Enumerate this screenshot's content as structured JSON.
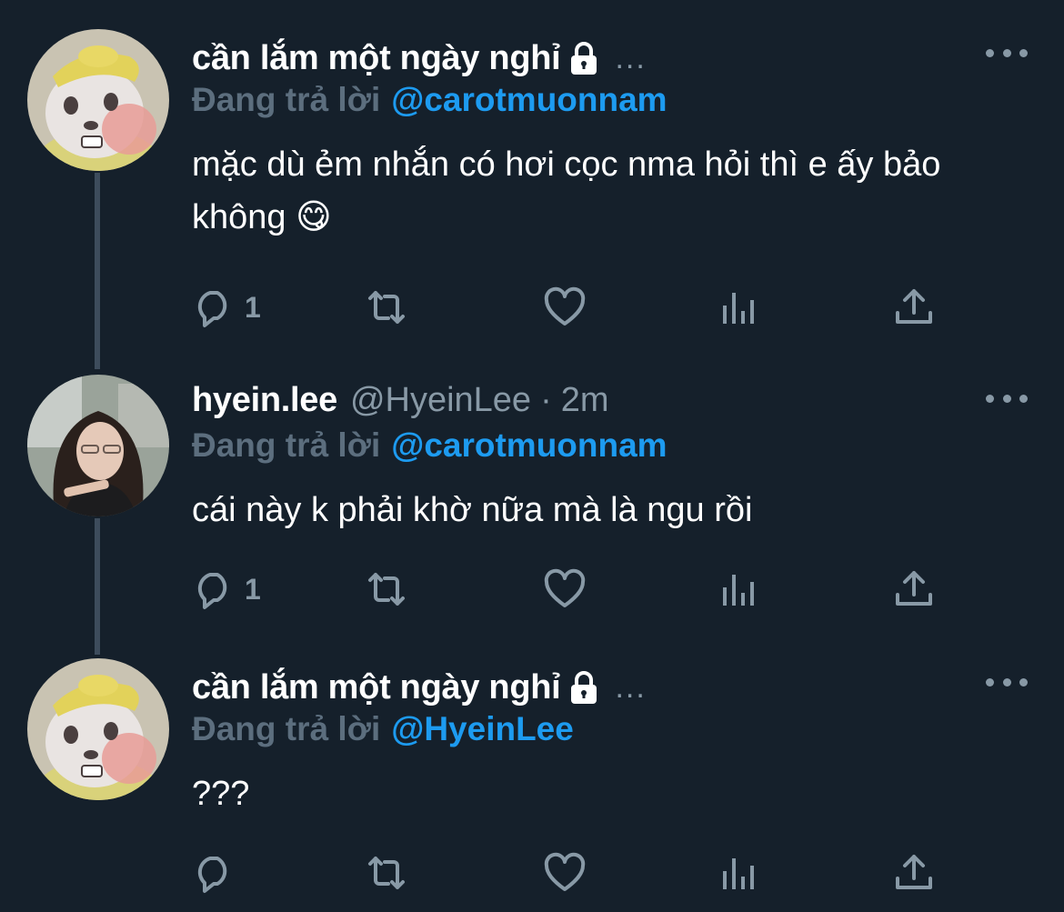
{
  "tweets": [
    {
      "display_name": "cần lắm một ngày nghỉ",
      "handle": "",
      "time": "",
      "truncated": "...",
      "replying_label": "Đang trả lời",
      "replying_to": "@carotmuonnam",
      "text": "mặc dù ẻm nhắn có hơi cọc nma hỏi thì e ấy bảo không 😋",
      "reply_count": "1",
      "avatar": "cartoon-character"
    },
    {
      "display_name": "hyein.lee",
      "handle": "@HyeinLee",
      "time": "2m",
      "truncated": "",
      "replying_label": "Đang trả lời",
      "replying_to": "@carotmuonnam",
      "text": "cái này k phải khờ nữa mà là ngu rồi",
      "reply_count": "1",
      "avatar": "photo-portrait"
    },
    {
      "display_name": "cần lắm một ngày nghỉ",
      "handle": "",
      "time": "",
      "truncated": "...",
      "replying_label": "Đang trả lời",
      "replying_to": "@HyeinLee",
      "text": "???",
      "reply_count": "",
      "avatar": "cartoon-character"
    }
  ],
  "separator": "·",
  "colors": {
    "background": "#15202b",
    "accent": "#1d9bf0",
    "muted": "#8899a6",
    "thread_line": "#3d4c5c"
  },
  "icons": [
    "lock-icon",
    "more-icon",
    "reply-icon",
    "retweet-icon",
    "like-icon",
    "analytics-icon",
    "share-icon"
  ]
}
